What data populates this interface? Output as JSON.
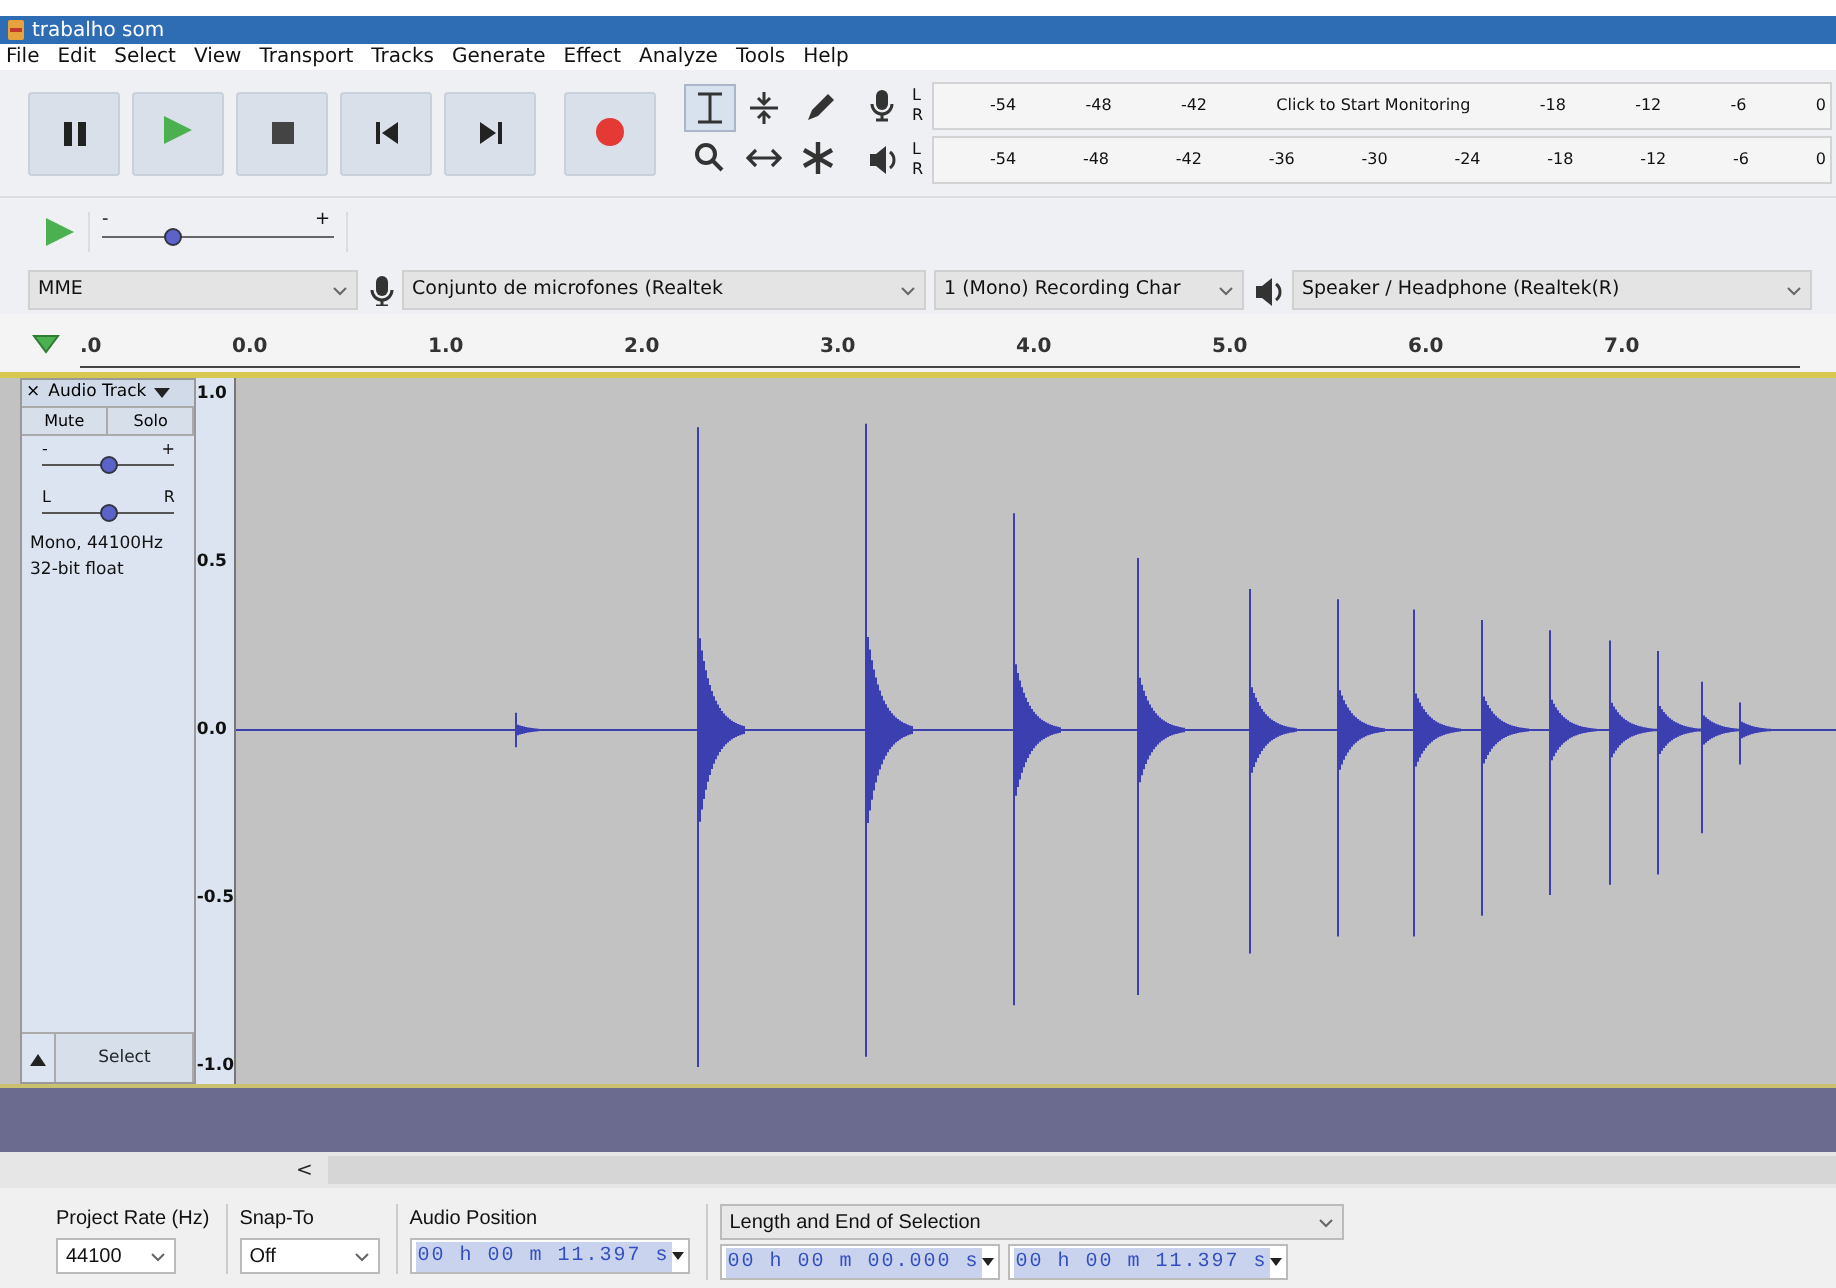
{
  "window": {
    "title": "trabalho som"
  },
  "menu": [
    "File",
    "Edit",
    "Select",
    "View",
    "Transport",
    "Tracks",
    "Generate",
    "Effect",
    "Analyze",
    "Tools",
    "Help"
  ],
  "tools": [
    {
      "selected": true
    },
    {
      "selected": false
    },
    {
      "selected": false
    },
    {
      "selected": false
    },
    {
      "selected": false
    },
    {
      "selected": false
    }
  ],
  "meters": [
    {
      "kind": "recording",
      "channels": [
        "L",
        "R"
      ],
      "scale": [
        "-54",
        "-48",
        "-42",
        "Click to Start Monitoring",
        "-18",
        "-12",
        "-6",
        "0"
      ]
    },
    {
      "kind": "playback",
      "channels": [
        "L",
        "R"
      ],
      "scale": [
        "-54",
        "-48",
        "-42",
        "-36",
        "-30",
        "-24",
        "-18",
        "-12",
        "-6",
        "0"
      ]
    }
  ],
  "play_at_speed": {
    "min": "-",
    "max": "+",
    "level": 0.3
  },
  "devices": {
    "host": "MME",
    "recording_device": "Conjunto de microfones (Realtek",
    "recording_channels": "1 (Mono) Recording Char",
    "playback_device": "Speaker / Headphone (Realtek(R)"
  },
  "timeline": {
    "ticks": [
      ".0",
      "0.0",
      "1.0",
      "2.0",
      "3.0",
      "4.0",
      "5.0",
      "6.0",
      "7.0"
    ]
  },
  "track": {
    "close": "×",
    "name": "Audio Track",
    "buttons": [
      "Mute",
      "Solo"
    ],
    "gain": {
      "min": "-",
      "max": "+",
      "level": 0.5
    },
    "pan": {
      "min": "L",
      "max": "R",
      "level": 0.5
    },
    "info": [
      "Mono, 44100Hz",
      "32-bit float"
    ],
    "select_button": "Select",
    "y_axis": [
      "1.0",
      "0.5",
      "0.0",
      "-0.5",
      "-1.0"
    ]
  },
  "scrollbar": {
    "left_arrow": "<"
  },
  "selection_toolbar": {
    "project_rate": {
      "label": "Project Rate (Hz)",
      "value": "44100"
    },
    "snap_to": {
      "label": "Snap-To",
      "value": "Off"
    },
    "audio_position": {
      "label": "Audio Position",
      "value": "00 h 00 m 11.397 s"
    },
    "selection": {
      "label": "Length and End of Selection",
      "values": [
        "00 h 00 m 00.000 s",
        "00 h 00 m 11.397 s"
      ]
    }
  }
}
